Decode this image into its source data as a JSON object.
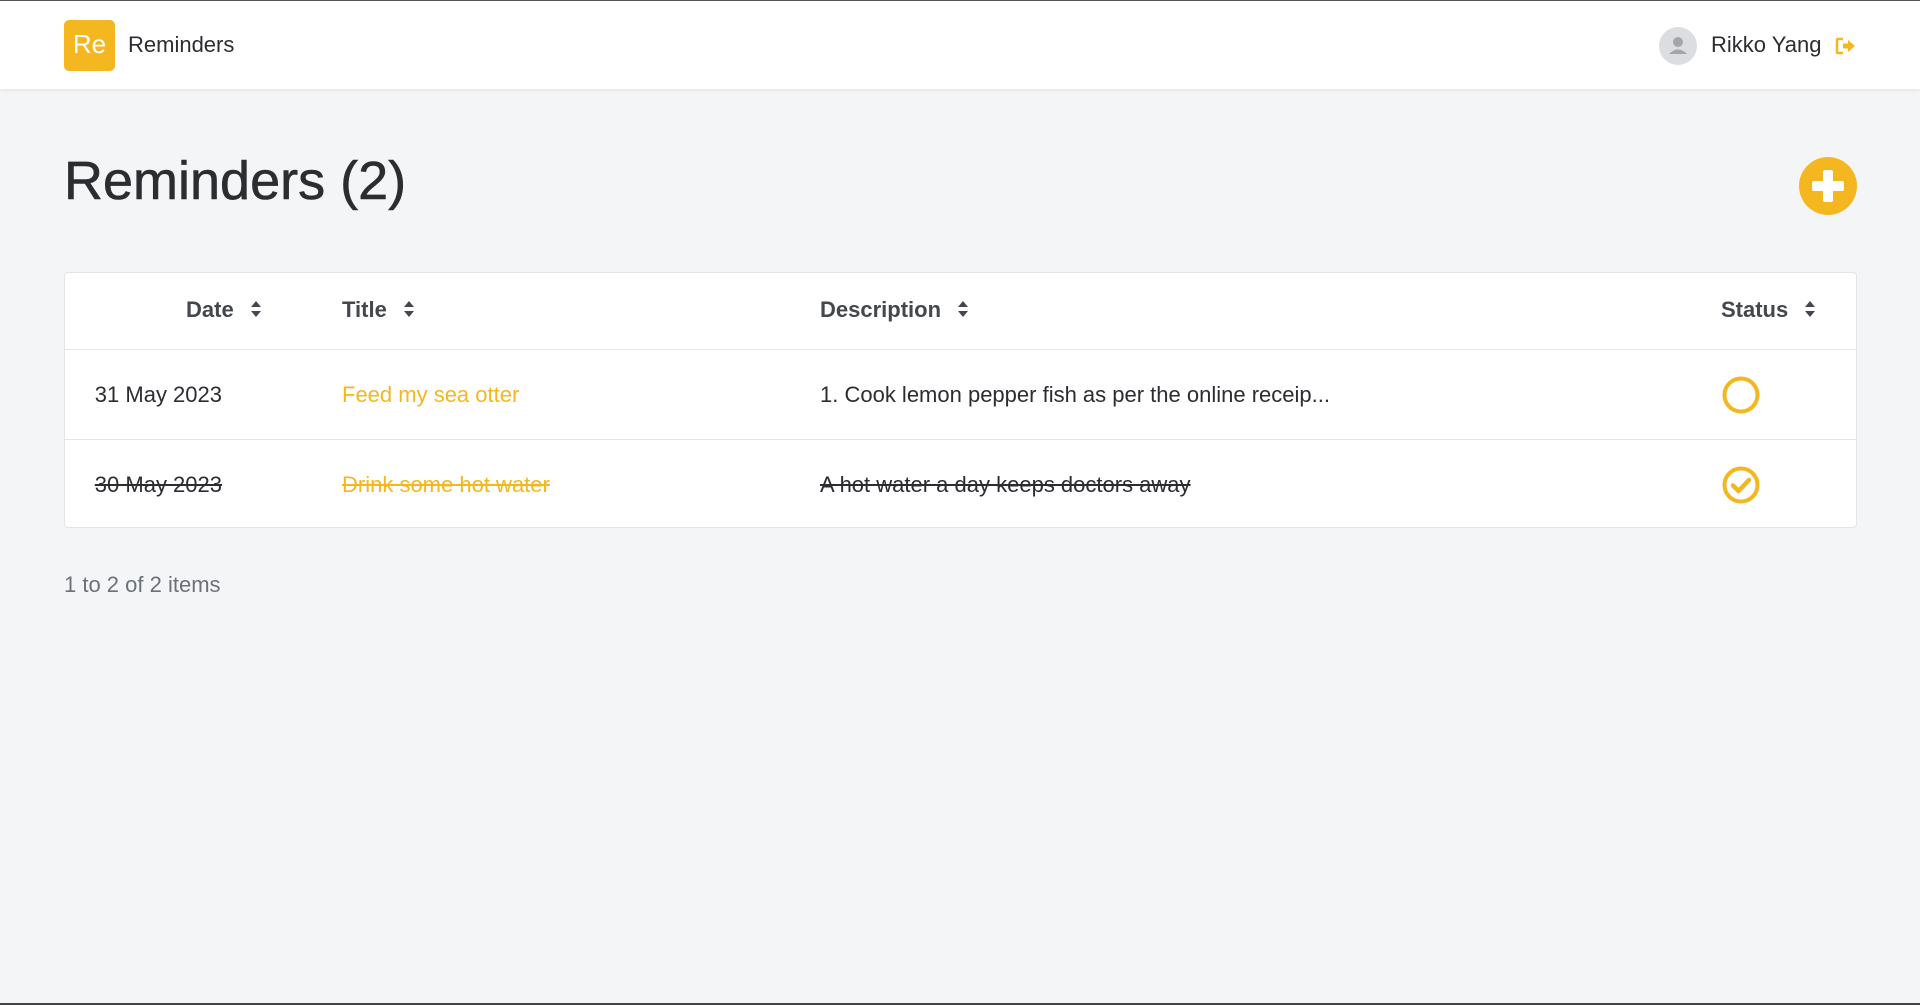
{
  "header": {
    "logo_text": "Re",
    "app_name": "Reminders",
    "user_name": "Rikko Yang"
  },
  "page": {
    "title": "Reminders (2)",
    "add_icon": "plus-circle-icon"
  },
  "table": {
    "columns": [
      "Date",
      "Title",
      "Description",
      "Status"
    ],
    "rows": [
      {
        "date": "31 May 2023",
        "title": "Feed my sea otter",
        "description": "1. Cook lemon pepper fish as per the online receip...",
        "status": "pending",
        "status_icon": "empty-circle-icon"
      },
      {
        "date": "30 May 2023",
        "title": "Drink some hot water",
        "description": "A hot water a day keeps doctors away",
        "status": "done",
        "status_icon": "check-circle-icon"
      }
    ]
  },
  "pagination": {
    "summary": "1 to 2 of 2 items"
  },
  "colors": {
    "accent": "#f4b71f",
    "background": "#f4f5f7",
    "text": "#2b2d31",
    "muted": "#6c7078"
  }
}
